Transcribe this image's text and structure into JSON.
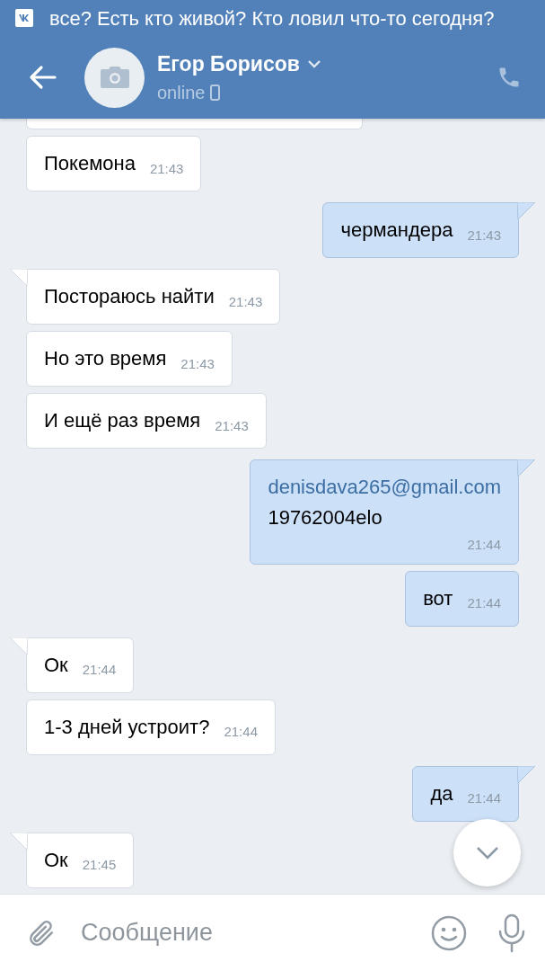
{
  "notification": {
    "text": "все? Есть кто живой? Кто ловил что-то сегодня?"
  },
  "header": {
    "name": "Егор Борисов",
    "status": "online"
  },
  "messages": [
    {
      "outgoing": false,
      "text": "Покемона",
      "time": "21:43",
      "tail": false
    },
    {
      "outgoing": true,
      "text": "чермандера",
      "time": "21:43",
      "tail": true
    },
    {
      "outgoing": false,
      "text": "Постораюсь найти",
      "time": "21:43",
      "tail": true
    },
    {
      "outgoing": false,
      "text": "Но это время",
      "time": "21:43",
      "tail": false
    },
    {
      "outgoing": false,
      "text": "И ещё раз время",
      "time": "21:43",
      "tail": false
    },
    {
      "outgoing": true,
      "link": "denisdava265@gmail.com",
      "text": "19762004elo",
      "time": "21:44",
      "tail": true
    },
    {
      "outgoing": true,
      "text": "вот",
      "time": "21:44",
      "tail": false
    },
    {
      "outgoing": false,
      "text": "Ок",
      "time": "21:44",
      "tail": true
    },
    {
      "outgoing": false,
      "text": "1-3 дней устроит?",
      "time": "21:44",
      "tail": false
    },
    {
      "outgoing": true,
      "text": "да",
      "time": "21:44",
      "tail": true
    },
    {
      "outgoing": false,
      "text": "Ок",
      "time": "21:45",
      "tail": true
    }
  ],
  "composer": {
    "placeholder": "Сообщение"
  }
}
